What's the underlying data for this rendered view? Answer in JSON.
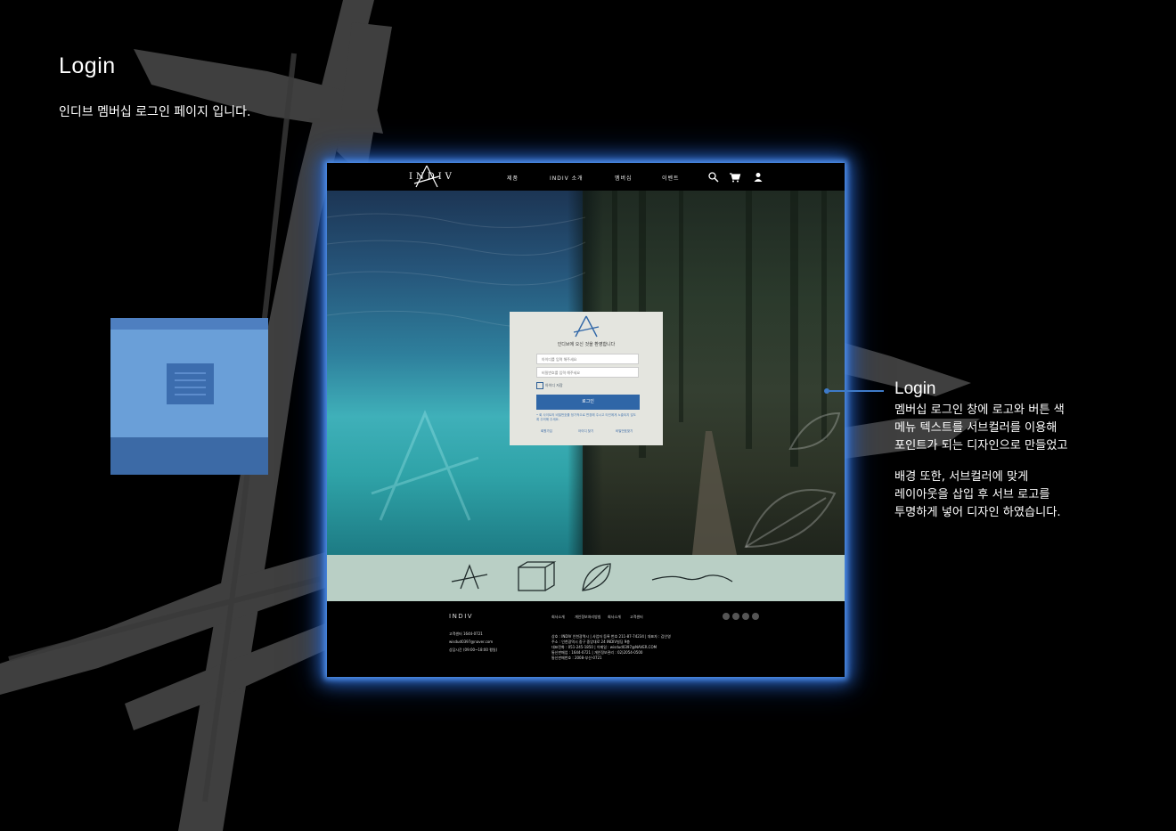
{
  "page": {
    "title": "Login",
    "description": "인디브 멤버십 로그인 페이지 입니다."
  },
  "mockup": {
    "logo": "INDIV",
    "nav_items": [
      "제품",
      "INDIV 소개",
      "멤버십",
      "이벤트"
    ],
    "nav_icons": [
      "search-icon",
      "cart-icon",
      "user-icon"
    ],
    "login": {
      "welcome": "인디브에 오신 것을 환영합니다",
      "id_placeholder": "아이디를 입력 해주세요",
      "pw_placeholder": "비밀번호를 입력 해주세요",
      "remember_label": "아이디 저장",
      "login_button": "로그인",
      "notice": "• 회 사이트의 비밀번호를 정기적으로 변경해 주시고 타인에게 노출되지 않도록 주의해 주세요.",
      "links": [
        "회원가입",
        "아이디 찾기",
        "비밀번호찾기"
      ]
    },
    "footer": {
      "logo": "INDIV",
      "links": [
        "회사소개",
        "개인정보처리방침",
        "회사소개",
        "고객센터"
      ],
      "contact": [
        "고객센터 1644-0721",
        "wisdud0397@naver.com",
        "상담시간 (09:00~18:00 평일)"
      ],
      "company_info": [
        "상호 : INDIV 인천광역시 | 사업자 등록 번호 211-87-74234 | 대표자 : 김인영",
        "주소 : 인천광역시 중구 중앙대로 24 INDIV빌딩 9층",
        "대표전화 : 051-245-1850 | 이메일 : wisdud0397@NAVER.COM",
        "통신판매업 : 1644-0721 | 개인정보관리 : 02)2054-0500",
        "통신판매번호 : 2008-부산-0721"
      ]
    }
  },
  "annotation": {
    "title": "Login",
    "lines": [
      "멤버십 로그인 창에 로고와 버튼 색",
      "메뉴 텍스트를 서브컬러를 이용해",
      "포인트가 되는 디자인으로 만들었고",
      "",
      "배경 또한, 서브컬러에 맞게",
      "레이아웃을 삽입 후 서브 로고를",
      "투명하게 넣어 디자인 하였습니다."
    ]
  },
  "colors": {
    "accent": "#2f66a7",
    "glow": "#4f8ee8",
    "strip": "#b9cfc5",
    "wireframe": "#6a9fd8"
  }
}
